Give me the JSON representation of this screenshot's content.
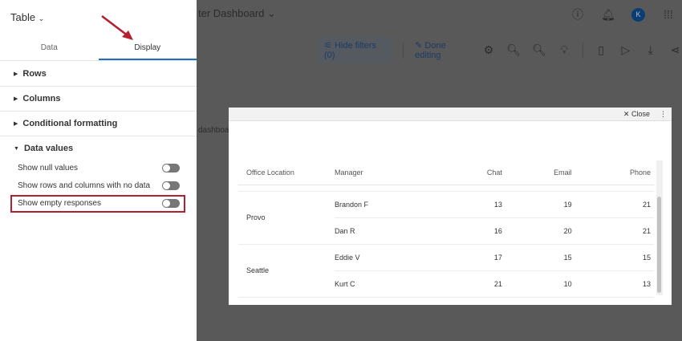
{
  "background": {
    "dashboard_title": "ter Dashboard",
    "breadcrumb_fragment": "dashboa",
    "user_initial": "K",
    "toolbar": {
      "hide_filters": "Hide filters (0)",
      "done_editing": "Done editing"
    }
  },
  "panel": {
    "title": "Table",
    "tabs": [
      {
        "label": "Data"
      },
      {
        "label": "Display",
        "active": true
      }
    ],
    "sections": [
      {
        "label": "Rows"
      },
      {
        "label": "Columns"
      },
      {
        "label": "Conditional formatting"
      },
      {
        "label": "Data values",
        "expanded": true
      }
    ],
    "options": [
      {
        "label": "Show null values",
        "on": false
      },
      {
        "label": "Show rows and columns with no data",
        "on": false
      },
      {
        "label": "Show empty responses",
        "on": false,
        "highlighted": true
      }
    ]
  },
  "modal": {
    "close_label": "Close",
    "columns": [
      "Office Location",
      "Manager",
      "Chat",
      "Email",
      "Phone"
    ],
    "groups": [
      {
        "location": "Provo",
        "rows": [
          {
            "manager": "Brandon F",
            "chat": "13",
            "email": "19",
            "phone": "21"
          },
          {
            "manager": "Dan R",
            "chat": "16",
            "email": "20",
            "phone": "21"
          }
        ]
      },
      {
        "location": "Seattle",
        "rows": [
          {
            "manager": "Eddie V",
            "chat": "17",
            "email": "15",
            "phone": "15"
          },
          {
            "manager": "Kurt C",
            "chat": "21",
            "email": "10",
            "phone": "13"
          }
        ]
      }
    ]
  },
  "colors": {
    "highlight": "#b3202f",
    "accent": "#1f6fc5"
  }
}
